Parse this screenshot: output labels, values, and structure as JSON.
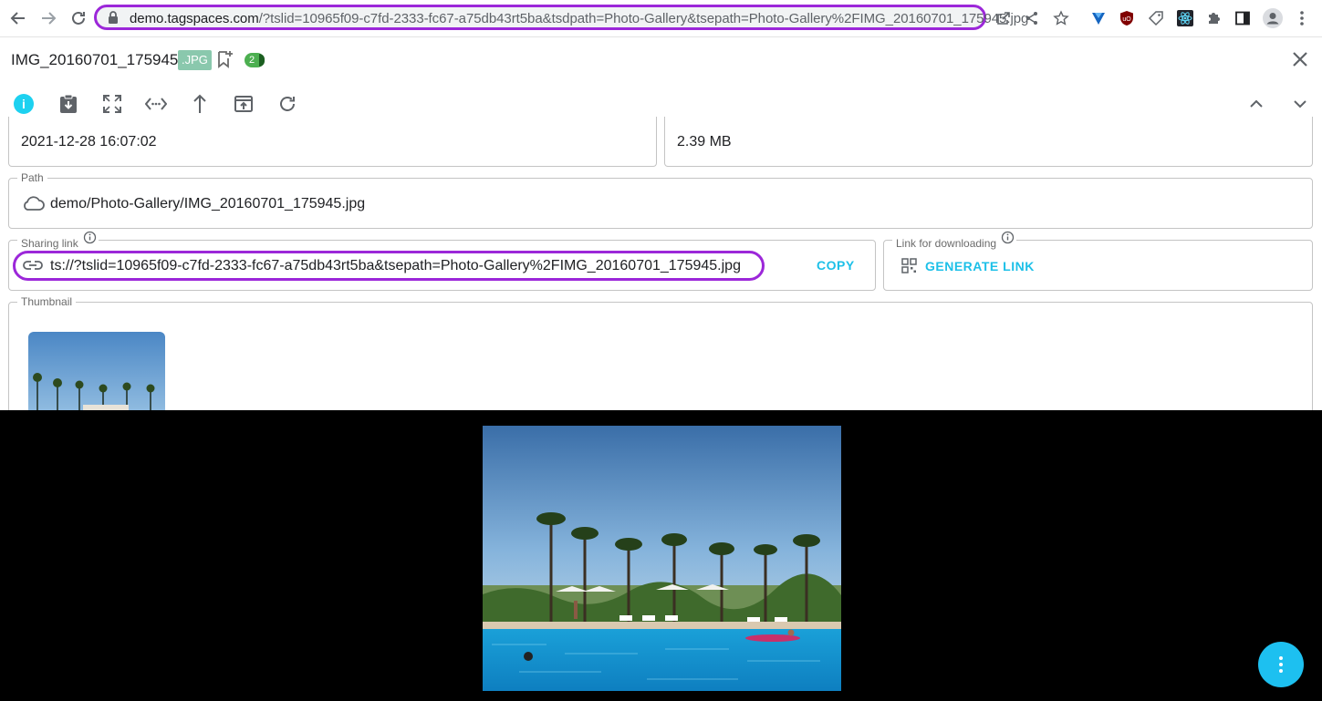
{
  "browser": {
    "url_host": "demo.tagspaces.com",
    "url_path": "/?tslid=10965f09-c7fd-2333-fc67-a75db43rt5ba&tsdpath=Photo-Gallery&tsepath=Photo-Gallery%2FIMG_20160701_175945.jpg",
    "extensions": [
      "open-in-new-icon",
      "share-icon",
      "star-icon",
      "heart-extension-icon",
      "ublock-icon",
      "tag-extension-icon",
      "react-devtools-icon",
      "puzzle-icon",
      "side-panel-icon",
      "profile-icon",
      "menu-dots-icon"
    ]
  },
  "header": {
    "file_name": "IMG_20160701_175945",
    "extension": ".JPG",
    "tag_count": "2"
  },
  "toolbar": {
    "icons": [
      "info-icon",
      "save-download-icon",
      "fullscreen-icon",
      "open-nav-icon",
      "open-parent-icon",
      "open-new-window-icon",
      "reload-icon"
    ]
  },
  "properties": {
    "date_modified": "2021-12-28 16:07:02",
    "size": "2.39 MB",
    "path_label": "Path",
    "path_value": "demo/Photo-Gallery/IMG_20160701_175945.jpg",
    "sharing_label": "Sharing link",
    "sharing_value": "ts://?tslid=10965f09-c7fd-2333-fc67-a75db43rt5ba&tsepath=Photo-Gallery%2FIMG_20160701_175945.jpg",
    "copy_label": "COPY",
    "download_label": "Link for downloading",
    "generate_label": "GENERATE LINK",
    "thumbnail_label": "Thumbnail"
  },
  "colors": {
    "accent": "#1dc0e8",
    "highlight": "#9c27d9",
    "tag_green": "#4caf50",
    "ext_badge": "#8ac8ad"
  }
}
